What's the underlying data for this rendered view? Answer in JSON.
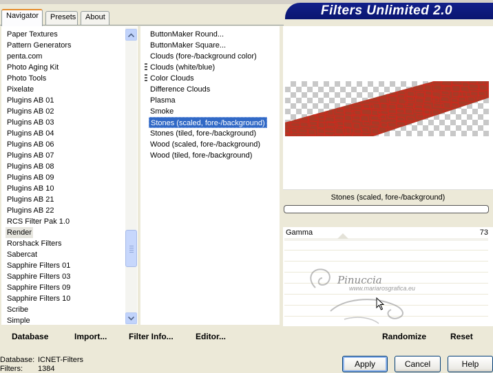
{
  "app": {
    "title": "Filters Unlimited 2.0"
  },
  "taskbar_fragments": [
    "",
    "",
    "",
    "",
    ""
  ],
  "tabs": [
    {
      "label": "Navigator",
      "active": true
    },
    {
      "label": "Presets",
      "active": false
    },
    {
      "label": "About",
      "active": false
    }
  ],
  "categories": {
    "items": [
      "Paper Textures",
      "Pattern Generators",
      "penta.com",
      "Photo Aging Kit",
      "Photo Tools",
      "Pixelate",
      "Plugins AB 01",
      "Plugins AB 02",
      "Plugins AB 03",
      "Plugins AB 04",
      "Plugins AB 06",
      "Plugins AB 07",
      "Plugins AB 08",
      "Plugins AB 09",
      "Plugins AB 10",
      "Plugins AB 21",
      "Plugins AB 22",
      "RCS Filter Pak 1.0",
      "Render",
      "Rorshack Filters",
      "Sabercat",
      "Sapphire Filters 01",
      "Sapphire Filters 03",
      "Sapphire Filters 09",
      "Sapphire Filters 10",
      "Scribe",
      "Simple"
    ],
    "selected": "Render"
  },
  "filters": {
    "items": [
      "ButtonMaker Round...",
      "ButtonMaker Square...",
      "Clouds (fore-/background color)",
      "Clouds (white/blue)",
      "Color Clouds",
      "Difference Clouds",
      "Plasma",
      "Smoke",
      "Stones (scaled, fore-/background)",
      "Stones (tiled, fore-/background)",
      "Wood (scaled, fore-/background)",
      "Wood (tiled, fore-/background)"
    ],
    "selected": "Stones (scaled, fore-/background)"
  },
  "preview": {
    "filter_name": "Stones (scaled, fore-/background)",
    "stone_color": "#a83a26",
    "crack_color": "#cc2a1e",
    "progress": 0
  },
  "params": [
    {
      "name": "Gamma",
      "value": "73"
    }
  ],
  "toolbar": {
    "database": "Database",
    "import": "Import...",
    "filter_info": "Filter Info...",
    "editor": "Editor...",
    "randomize": "Randomize",
    "reset": "Reset"
  },
  "status": {
    "database_label": "Database:",
    "database_value": "ICNET-Filters",
    "filters_label": "Filters:",
    "filters_value": "1384"
  },
  "buttons": {
    "apply": "Apply",
    "cancel": "Cancel",
    "help": "Help"
  },
  "watermark": {
    "name": "Pinuccia",
    "url": "www.mariarosgrafica.eu"
  },
  "colors": {
    "banner": "#0a1570",
    "selection": "#3169c6",
    "active_tab_accent": "#e68b2c"
  }
}
